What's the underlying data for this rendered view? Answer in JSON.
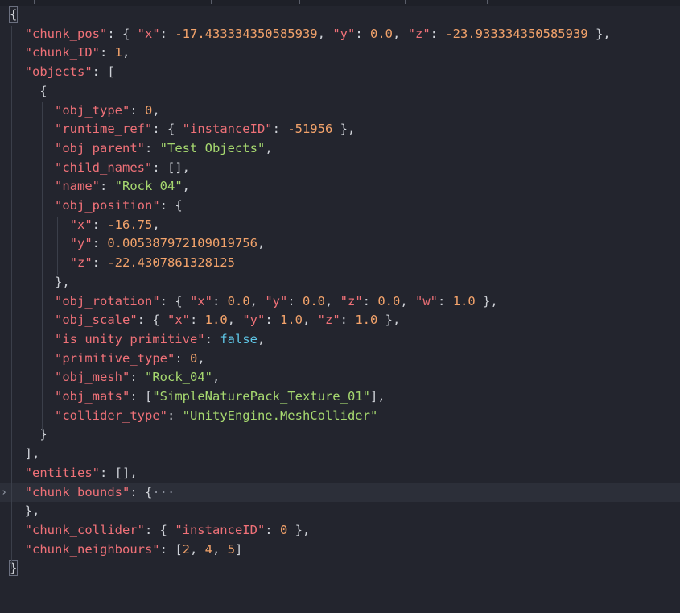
{
  "lines": [
    [
      {
        "t": "{",
        "c": "pun",
        "box": true
      }
    ],
    [
      {
        "t": "  "
      },
      {
        "t": "\"chunk_pos\"",
        "c": "key"
      },
      {
        "t": ": { ",
        "c": "pun"
      },
      {
        "t": "\"x\"",
        "c": "key"
      },
      {
        "t": ": ",
        "c": "pun"
      },
      {
        "t": "-17.433334350585939",
        "c": "num"
      },
      {
        "t": ", ",
        "c": "pun"
      },
      {
        "t": "\"y\"",
        "c": "key"
      },
      {
        "t": ": ",
        "c": "pun"
      },
      {
        "t": "0.0",
        "c": "num"
      },
      {
        "t": ", ",
        "c": "pun"
      },
      {
        "t": "\"z\"",
        "c": "key"
      },
      {
        "t": ": ",
        "c": "pun"
      },
      {
        "t": "-23.933334350585939",
        "c": "num"
      },
      {
        "t": " },",
        "c": "pun"
      }
    ],
    [
      {
        "t": "  "
      },
      {
        "t": "\"chunk_ID\"",
        "c": "key"
      },
      {
        "t": ": ",
        "c": "pun"
      },
      {
        "t": "1",
        "c": "num"
      },
      {
        "t": ",",
        "c": "pun"
      }
    ],
    [
      {
        "t": "  "
      },
      {
        "t": "\"objects\"",
        "c": "key"
      },
      {
        "t": ": [",
        "c": "pun"
      }
    ],
    [
      {
        "t": "    "
      },
      {
        "t": "{",
        "c": "pun"
      }
    ],
    [
      {
        "t": "      "
      },
      {
        "t": "\"obj_type\"",
        "c": "key"
      },
      {
        "t": ": ",
        "c": "pun"
      },
      {
        "t": "0",
        "c": "num"
      },
      {
        "t": ",",
        "c": "pun"
      }
    ],
    [
      {
        "t": "      "
      },
      {
        "t": "\"runtime_ref\"",
        "c": "key"
      },
      {
        "t": ": { ",
        "c": "pun"
      },
      {
        "t": "\"instanceID\"",
        "c": "key"
      },
      {
        "t": ": ",
        "c": "pun"
      },
      {
        "t": "-51956",
        "c": "num"
      },
      {
        "t": " },",
        "c": "pun"
      }
    ],
    [
      {
        "t": "      "
      },
      {
        "t": "\"obj_parent\"",
        "c": "key"
      },
      {
        "t": ": ",
        "c": "pun"
      },
      {
        "t": "\"Test Objects\"",
        "c": "str"
      },
      {
        "t": ",",
        "c": "pun"
      }
    ],
    [
      {
        "t": "      "
      },
      {
        "t": "\"child_names\"",
        "c": "key"
      },
      {
        "t": ": [],",
        "c": "pun"
      }
    ],
    [
      {
        "t": "      "
      },
      {
        "t": "\"name\"",
        "c": "key"
      },
      {
        "t": ": ",
        "c": "pun"
      },
      {
        "t": "\"Rock_04\"",
        "c": "str"
      },
      {
        "t": ",",
        "c": "pun"
      }
    ],
    [
      {
        "t": "      "
      },
      {
        "t": "\"obj_position\"",
        "c": "key"
      },
      {
        "t": ": {",
        "c": "pun"
      }
    ],
    [
      {
        "t": "        "
      },
      {
        "t": "\"x\"",
        "c": "key"
      },
      {
        "t": ": ",
        "c": "pun"
      },
      {
        "t": "-16.75",
        "c": "num"
      },
      {
        "t": ",",
        "c": "pun"
      }
    ],
    [
      {
        "t": "        "
      },
      {
        "t": "\"y\"",
        "c": "key"
      },
      {
        "t": ": ",
        "c": "pun"
      },
      {
        "t": "0.005387972109019756",
        "c": "num"
      },
      {
        "t": ",",
        "c": "pun"
      }
    ],
    [
      {
        "t": "        "
      },
      {
        "t": "\"z\"",
        "c": "key"
      },
      {
        "t": ": ",
        "c": "pun"
      },
      {
        "t": "-22.4307861328125",
        "c": "num"
      }
    ],
    [
      {
        "t": "      "
      },
      {
        "t": "},",
        "c": "pun"
      }
    ],
    [
      {
        "t": "      "
      },
      {
        "t": "\"obj_rotation\"",
        "c": "key"
      },
      {
        "t": ": { ",
        "c": "pun"
      },
      {
        "t": "\"x\"",
        "c": "key"
      },
      {
        "t": ": ",
        "c": "pun"
      },
      {
        "t": "0.0",
        "c": "num"
      },
      {
        "t": ", ",
        "c": "pun"
      },
      {
        "t": "\"y\"",
        "c": "key"
      },
      {
        "t": ": ",
        "c": "pun"
      },
      {
        "t": "0.0",
        "c": "num"
      },
      {
        "t": ", ",
        "c": "pun"
      },
      {
        "t": "\"z\"",
        "c": "key"
      },
      {
        "t": ": ",
        "c": "pun"
      },
      {
        "t": "0.0",
        "c": "num"
      },
      {
        "t": ", ",
        "c": "pun"
      },
      {
        "t": "\"w\"",
        "c": "key"
      },
      {
        "t": ": ",
        "c": "pun"
      },
      {
        "t": "1.0",
        "c": "num"
      },
      {
        "t": " },",
        "c": "pun"
      }
    ],
    [
      {
        "t": "      "
      },
      {
        "t": "\"obj_scale\"",
        "c": "key"
      },
      {
        "t": ": { ",
        "c": "pun"
      },
      {
        "t": "\"x\"",
        "c": "key"
      },
      {
        "t": ": ",
        "c": "pun"
      },
      {
        "t": "1.0",
        "c": "num"
      },
      {
        "t": ", ",
        "c": "pun"
      },
      {
        "t": "\"y\"",
        "c": "key"
      },
      {
        "t": ": ",
        "c": "pun"
      },
      {
        "t": "1.0",
        "c": "num"
      },
      {
        "t": ", ",
        "c": "pun"
      },
      {
        "t": "\"z\"",
        "c": "key"
      },
      {
        "t": ": ",
        "c": "pun"
      },
      {
        "t": "1.0",
        "c": "num"
      },
      {
        "t": " },",
        "c": "pun"
      }
    ],
    [
      {
        "t": "      "
      },
      {
        "t": "\"is_unity_primitive\"",
        "c": "key"
      },
      {
        "t": ": ",
        "c": "pun"
      },
      {
        "t": "false",
        "c": "kw"
      },
      {
        "t": ",",
        "c": "pun"
      }
    ],
    [
      {
        "t": "      "
      },
      {
        "t": "\"primitive_type\"",
        "c": "key"
      },
      {
        "t": ": ",
        "c": "pun"
      },
      {
        "t": "0",
        "c": "num"
      },
      {
        "t": ",",
        "c": "pun"
      }
    ],
    [
      {
        "t": "      "
      },
      {
        "t": "\"obj_mesh\"",
        "c": "key"
      },
      {
        "t": ": ",
        "c": "pun"
      },
      {
        "t": "\"Rock_04\"",
        "c": "str"
      },
      {
        "t": ",",
        "c": "pun"
      }
    ],
    [
      {
        "t": "      "
      },
      {
        "t": "\"obj_mats\"",
        "c": "key"
      },
      {
        "t": ": [",
        "c": "pun"
      },
      {
        "t": "\"SimpleNaturePack_Texture_01\"",
        "c": "str"
      },
      {
        "t": "],",
        "c": "pun"
      }
    ],
    [
      {
        "t": "      "
      },
      {
        "t": "\"collider_type\"",
        "c": "key"
      },
      {
        "t": ": ",
        "c": "pun"
      },
      {
        "t": "\"UnityEngine.MeshCollider\"",
        "c": "str"
      }
    ],
    [
      {
        "t": "    "
      },
      {
        "t": "}",
        "c": "pun"
      }
    ],
    [
      {
        "t": "  "
      },
      {
        "t": "],",
        "c": "pun"
      }
    ],
    [
      {
        "t": "  "
      },
      {
        "t": "\"entities\"",
        "c": "key"
      },
      {
        "t": ": [],",
        "c": "pun"
      }
    ],
    [
      {
        "t": "  "
      },
      {
        "t": "\"chunk_bounds\"",
        "c": "key"
      },
      {
        "t": ": {",
        "c": "pun"
      },
      {
        "t": "···",
        "c": "ellipsis"
      }
    ],
    [
      {
        "t": "  "
      },
      {
        "t": "},",
        "c": "pun"
      }
    ],
    [
      {
        "t": "  "
      },
      {
        "t": "\"chunk_collider\"",
        "c": "key"
      },
      {
        "t": ": { ",
        "c": "pun"
      },
      {
        "t": "\"instanceID\"",
        "c": "key"
      },
      {
        "t": ": ",
        "c": "pun"
      },
      {
        "t": "0",
        "c": "num"
      },
      {
        "t": " },",
        "c": "pun"
      }
    ],
    [
      {
        "t": "  "
      },
      {
        "t": "\"chunk_neighbours\"",
        "c": "key"
      },
      {
        "t": ": [",
        "c": "pun"
      },
      {
        "t": "2",
        "c": "num"
      },
      {
        "t": ", ",
        "c": "pun"
      },
      {
        "t": "4",
        "c": "num"
      },
      {
        "t": ", ",
        "c": "pun"
      },
      {
        "t": "5",
        "c": "num"
      },
      {
        "t": "]",
        "c": "pun"
      }
    ],
    [
      {
        "t": "}",
        "c": "pun",
        "box": true
      }
    ]
  ],
  "folded_line": 25,
  "fold_icon": "chevron-right-icon",
  "colors": {
    "background": "#23252e",
    "key": "#f07178",
    "string": "#a6d86f",
    "number": "#f3a36b",
    "keyword": "#5fc6e6",
    "punctuation": "#cfd2d8",
    "current_line": "#2c2f39"
  }
}
